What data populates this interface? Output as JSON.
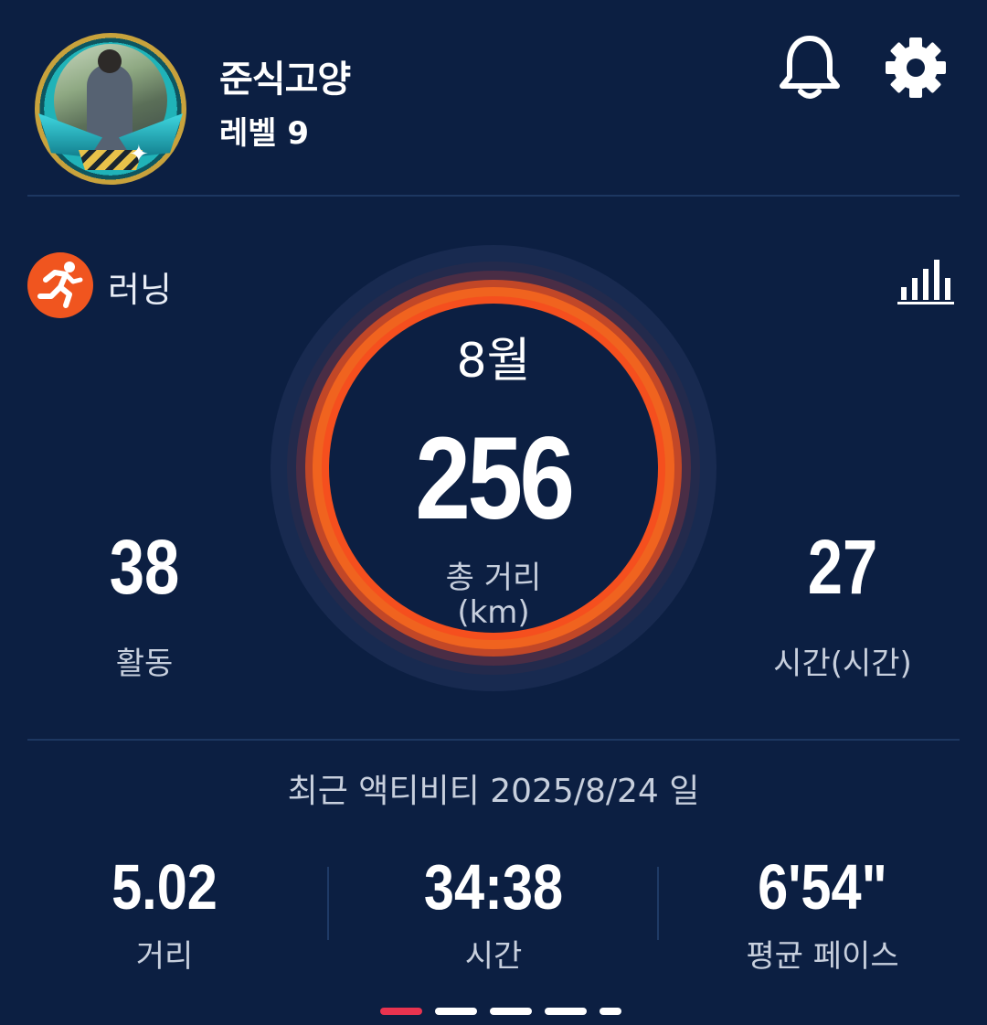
{
  "profile": {
    "name": "준식고양",
    "level": "레벨 9"
  },
  "header": {
    "bell_icon": "bell-icon",
    "settings_icon": "gear-icon"
  },
  "sport": {
    "icon": "running-person-icon",
    "label": "러닝",
    "chart_icon": "bar-chart-icon"
  },
  "summary": {
    "month": "8월",
    "total_distance": "256",
    "total_distance_label": "총 거리",
    "total_distance_unit": "(km)",
    "activities_value": "38",
    "activities_label": "활동",
    "hours_value": "27",
    "hours_label": "시간(시간)"
  },
  "recent": {
    "title": "최근 액티비티 2025/8/24 일",
    "distance_value": "5.02",
    "distance_label": "거리",
    "time_value": "34:38",
    "time_label": "시간",
    "pace_value": "6'54\"",
    "pace_label": "평균 페이스"
  },
  "pager": {
    "count": 5,
    "active_index": 0
  },
  "colors": {
    "background": "#0c1f42",
    "accent": "#f0551f",
    "ring_inner": "#f25a1f",
    "active_dot": "#e8334f"
  }
}
